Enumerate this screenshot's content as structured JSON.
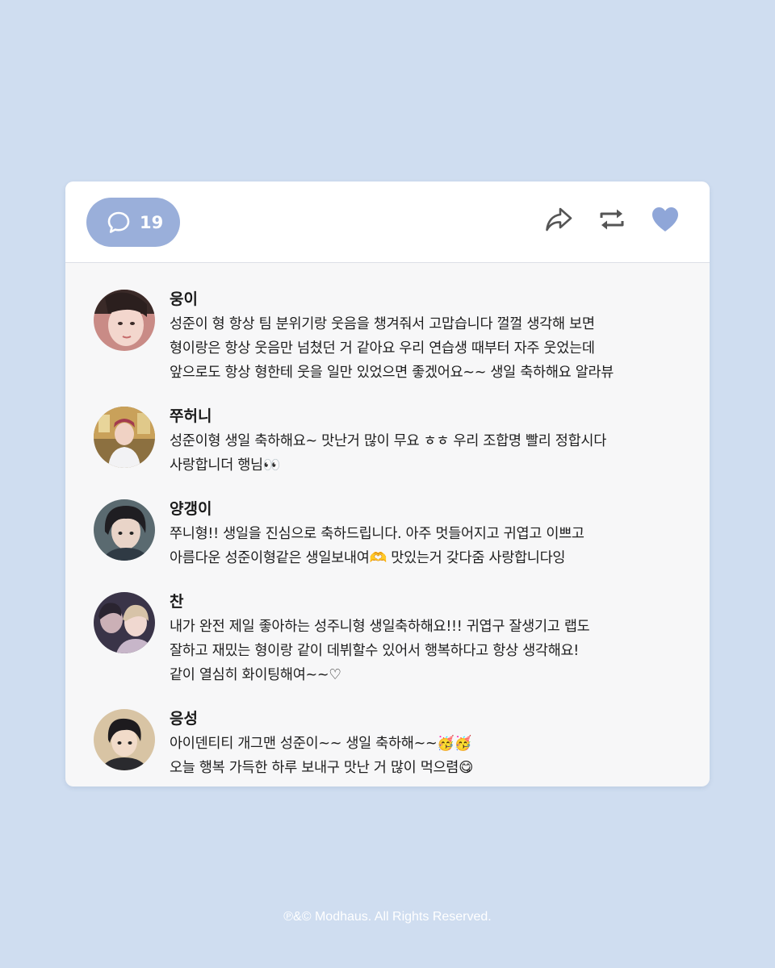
{
  "header": {
    "comment_count": "19",
    "icons": {
      "comment": "speech-bubble-icon",
      "share": "share-arrow-icon",
      "repost": "repost-icon",
      "like": "heart-icon"
    },
    "colors": {
      "pill": "#9aafda",
      "heart": "#8fa6d8",
      "icon": "#555555"
    }
  },
  "comments": [
    {
      "name": "웅이",
      "text": "성준이 형 항상 팀 분위기랑 웃음을 챙겨줘서 고맙습니다 껄껄 생각해 보면\n형이랑은 항상 웃음만 넘쳤던 거 같아요 우리 연습생 때부터 자주 웃었는데\n앞으로도 항상 형한테 웃을 일만 있었으면 좋겠어요~~ 생일 축하해요 알라뷰"
    },
    {
      "name": "쭈허니",
      "text": "성준이형 생일 축하해요~ 맛난거 많이 무요 ㅎㅎ 우리 조합명 빨리 정합시다\n사랑합니더 행님👀"
    },
    {
      "name": "양갱이",
      "text": "쭈니형!! 생일을 진심으로 축하드립니다. 아주 멋들어지고 귀엽고 이쁘고\n아름다운 성준이형같은 생일보내여🫶 맛있는거 갖다줌 사랑합니다잉"
    },
    {
      "name": "찬",
      "text": "내가 완전 제일 좋아하는 성주니형 생일축하해요!!! 귀엽구 잘생기고 랩도\n잘하고 재밌는 형이랑 같이 데뷔할수 있어서 행복하다고 항상 생각해요!\n같이 열심히 화이팅해여~~♡"
    },
    {
      "name": "응성",
      "text": "아이덴티티 개그맨 성준이~~ 생일 축하해~~🥳🥳\n오늘 행복 가득한 하루 보내구 맛난 거 많이 먹으렴😋"
    }
  ],
  "footer": {
    "copyright": "℗&© Modhaus. All Rights Reserved."
  }
}
